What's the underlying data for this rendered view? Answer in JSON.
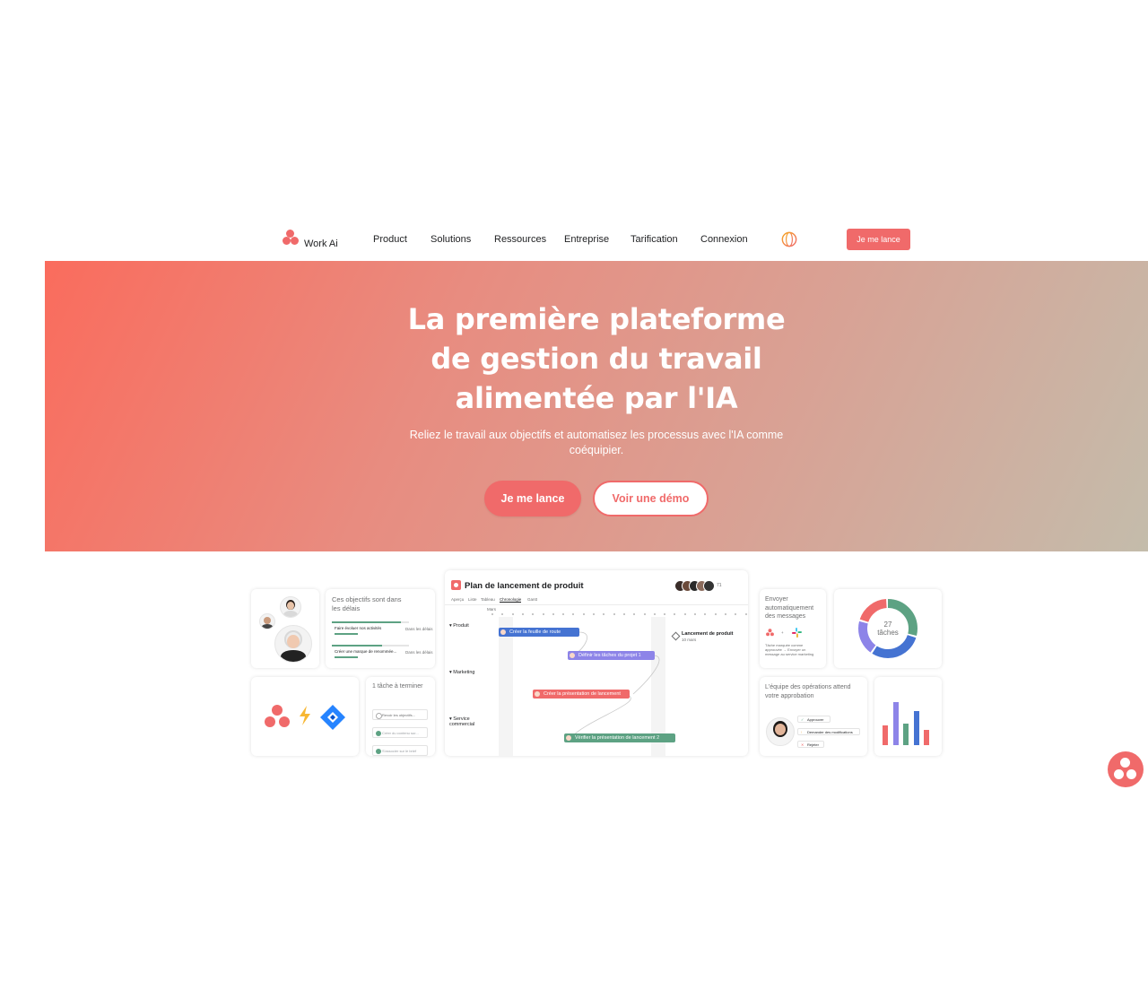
{
  "brand": {
    "name": "Work Ai",
    "accent": "#f06a6a"
  },
  "nav": {
    "links": [
      "Product",
      "Solutions",
      "Ressources",
      "Entreprise",
      "Tarification",
      "Connexion"
    ],
    "cta": "Je me lance",
    "globe_icon": "globe-icon"
  },
  "hero": {
    "title_lines": [
      "La première plateforme",
      "de gestion du travail",
      "alimentée par l'IA"
    ],
    "subtitle": "Reliez le travail aux objectifs et automatisez les processus avec l'IA comme coéquipier.",
    "primary_button": "Je me lance",
    "secondary_button": "Voir une démo",
    "gradient": [
      "#fa6c5d",
      "#c4bcab"
    ]
  },
  "cards": {
    "goals": {
      "title": "Ces objectifs sont dans les délais",
      "items": [
        {
          "label": "Faire évoluer nos activités",
          "status": "Dans les délais",
          "progress": 0.9
        },
        {
          "label": "Créer une marque de renommée...",
          "status": "Dans les délais",
          "progress": 0.65
        }
      ]
    },
    "tasks": {
      "title": "1 tâche à terminer",
      "items": [
        "Revoir les objectifs...",
        "Créer du contenu sur...",
        "S'associer sur le brief"
      ]
    },
    "gantt": {
      "title": "Plan de lancement de produit",
      "member_count": "71",
      "tabs": [
        "Aperçu",
        "Liste",
        "Tableau",
        "Chronologie",
        "Gantt"
      ],
      "active_tab": "Chronologie",
      "month": "Mars",
      "rows": [
        "Produit",
        "Marketing",
        "Service commercial"
      ],
      "bars": [
        {
          "label": "Créer la feuille de route",
          "color": "#4573d2"
        },
        {
          "label": "Définir les tâches du projet",
          "color": "#8d84e8",
          "count": "1"
        },
        {
          "label": "Créer la présentation de lancement",
          "color": "#f06a6a"
        },
        {
          "label": "Vérifier la présentation de lancement",
          "color": "#5da283",
          "count": "2"
        }
      ],
      "milestone": {
        "label": "Lancement de produit",
        "date": "10 mars"
      }
    },
    "messages": {
      "title": "Envoyer automatiquement des messages",
      "detail": "Tâche marquée comme approuvée → Envoyer un message au service marketing"
    },
    "donut": {
      "value": "27",
      "label": "tâches",
      "segments": [
        {
          "color": "#5da283",
          "fraction": 0.3
        },
        {
          "color": "#4573d2",
          "fraction": 0.3
        },
        {
          "color": "#8d84e8",
          "fraction": 0.2
        },
        {
          "color": "#f06a6a",
          "fraction": 0.2
        }
      ]
    },
    "approval": {
      "title": "L'équipe des opérations attend votre approbation",
      "options": [
        "Approuver",
        "Demander des modifications",
        "Rejeter"
      ]
    },
    "bars_chart": {
      "colors": [
        "#f06a6a",
        "#8d84e8",
        "#5da283",
        "#4573d2",
        "#f06a6a"
      ],
      "values": [
        0.45,
        1.0,
        0.5,
        0.8,
        0.35
      ]
    },
    "integrations": [
      "asana-logo-icon",
      "lightning-icon",
      "jira-logo-icon"
    ]
  }
}
